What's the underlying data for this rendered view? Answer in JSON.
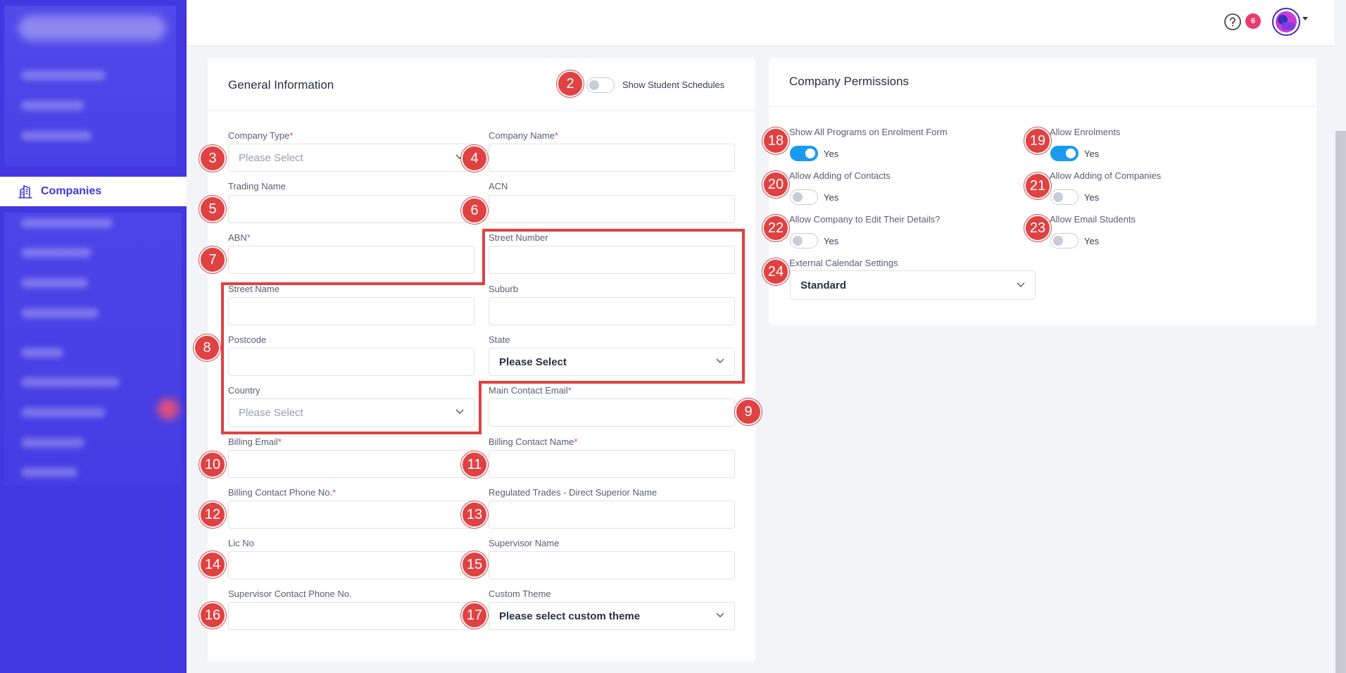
{
  "sidebar": {
    "active_item": "Companies"
  },
  "topbar": {
    "notification_count": "6"
  },
  "general": {
    "title": "General Information",
    "show_schedules_label": "Show Student Schedules",
    "fields": {
      "company_type": {
        "label": "Company Type",
        "placeholder": "Please Select"
      },
      "company_name": {
        "label": "Company Name"
      },
      "trading_name": {
        "label": "Trading Name"
      },
      "acn": {
        "label": "ACN"
      },
      "abn": {
        "label": "ABN"
      },
      "street_number": {
        "label": "Street Number"
      },
      "street_name": {
        "label": "Street Name"
      },
      "suburb": {
        "label": "Suburb"
      },
      "postcode": {
        "label": "Postcode"
      },
      "state": {
        "label": "State",
        "value": "Please Select"
      },
      "country": {
        "label": "Country",
        "placeholder": "Please Select"
      },
      "main_contact_email": {
        "label": "Main Contact Email"
      },
      "billing_email": {
        "label": "Billing Email"
      },
      "billing_contact_name": {
        "label": "Billing Contact Name"
      },
      "billing_contact_phone": {
        "label": "Billing Contact Phone No."
      },
      "regulated_trades": {
        "label": "Regulated Trades - Direct Superior Name"
      },
      "lic_no": {
        "label": "Lic No"
      },
      "supervisor_name": {
        "label": "Supervisor Name"
      },
      "supervisor_phone": {
        "label": "Supervisor Contact Phone No."
      },
      "custom_theme": {
        "label": "Custom Theme",
        "value": "Please select custom theme"
      }
    }
  },
  "permissions": {
    "title": "Company Permissions",
    "items": {
      "show_all_programs": {
        "label": "Show All Programs on Enrolment Form",
        "value": "Yes",
        "on": true
      },
      "allow_enrolments": {
        "label": "Allow Enrolments",
        "value": "Yes",
        "on": true
      },
      "allow_contacts": {
        "label": "Allow Adding of Contacts",
        "value": "Yes",
        "on": false
      },
      "allow_companies": {
        "label": "Allow Adding of Companies",
        "value": "Yes",
        "on": false
      },
      "allow_edit": {
        "label": "Allow Company to Edit Their Details?",
        "value": "Yes",
        "on": false
      },
      "allow_email": {
        "label": "Allow Email Students",
        "value": "Yes",
        "on": false
      }
    },
    "calendar": {
      "label": "External Calendar Settings",
      "value": "Standard"
    }
  },
  "markers": [
    "2",
    "3",
    "4",
    "5",
    "6",
    "7",
    "8",
    "9",
    "10",
    "11",
    "12",
    "13",
    "14",
    "15",
    "16",
    "17",
    "18",
    "19",
    "20",
    "21",
    "22",
    "23",
    "24"
  ],
  "colors": {
    "sidebar": "#4237e0",
    "accent": "#1a9bf0",
    "required": "#e83c6e",
    "marker": "#e04142"
  }
}
